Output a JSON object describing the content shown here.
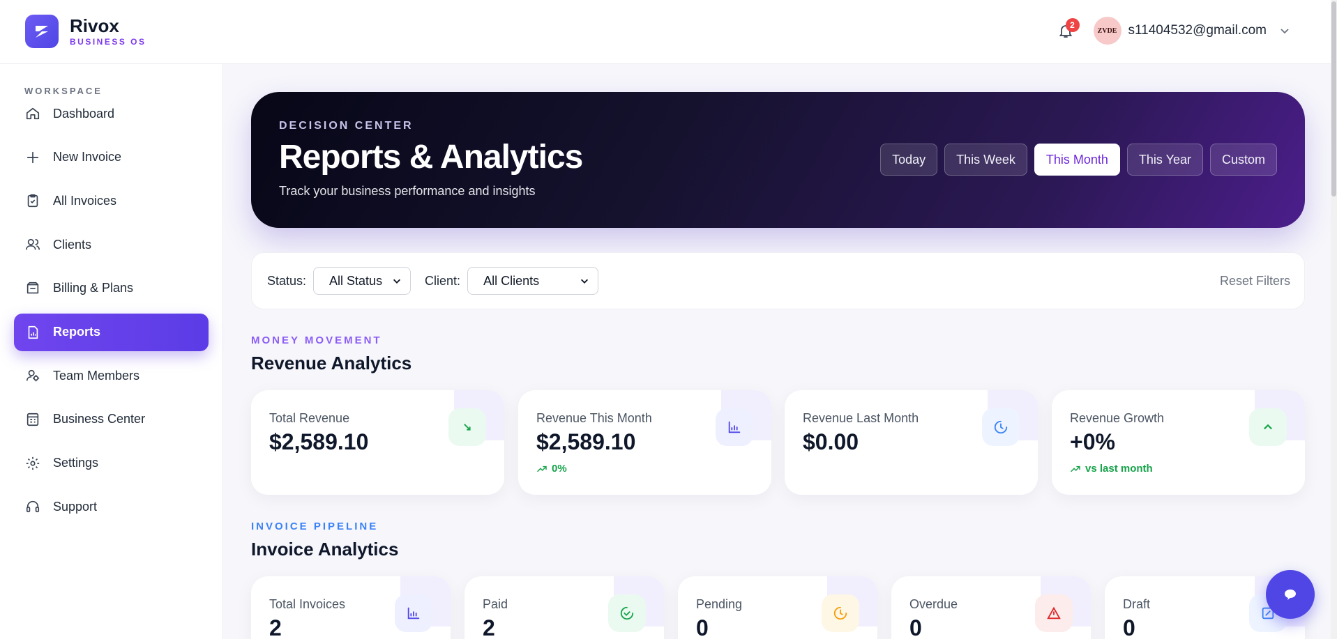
{
  "brand": {
    "name": "Rivox",
    "sub": "BUSINESS OS"
  },
  "header": {
    "notifications_count": "2",
    "avatar_text": "ZVDE",
    "user_email": "s11404532@gmail.com"
  },
  "sidebar": {
    "section_label": "WORKSPACE",
    "items": [
      {
        "label": "Dashboard",
        "icon": "home-icon"
      },
      {
        "label": "New Invoice",
        "icon": "plus-icon"
      },
      {
        "label": "All Invoices",
        "icon": "clipboard-check-icon"
      },
      {
        "label": "Clients",
        "icon": "users-icon"
      },
      {
        "label": "Billing & Plans",
        "icon": "wallet-icon"
      },
      {
        "label": "Reports",
        "icon": "report-icon",
        "active": true
      },
      {
        "label": "Team Members",
        "icon": "team-icon"
      },
      {
        "label": "Business Center",
        "icon": "building-icon"
      },
      {
        "label": "Settings",
        "icon": "gear-icon"
      },
      {
        "label": "Support",
        "icon": "headset-icon"
      }
    ]
  },
  "hero": {
    "kicker": "DECISION CENTER",
    "title": "Reports & Analytics",
    "subtitle": "Track your business performance and insights",
    "periods": [
      "Today",
      "This Week",
      "This Month",
      "This Year",
      "Custom"
    ],
    "active_period": "This Month"
  },
  "filters": {
    "status_label": "Status:",
    "status_value": "All Status",
    "client_label": "Client:",
    "client_value": "All Clients",
    "reset_label": "Reset Filters"
  },
  "revenue": {
    "kicker": "MONEY MOVEMENT",
    "title": "Revenue Analytics",
    "cards": [
      {
        "label": "Total Revenue",
        "value": "$2,589.10",
        "trend": "",
        "icon": "money-icon"
      },
      {
        "label": "Revenue This Month",
        "value": "$2,589.10",
        "trend": "0%",
        "icon": "chart-icon"
      },
      {
        "label": "Revenue Last Month",
        "value": "$0.00",
        "trend": "",
        "icon": "clock-icon"
      },
      {
        "label": "Revenue Growth",
        "value": "+0%",
        "trend": "vs last month",
        "icon": "chevron-up-icon"
      }
    ]
  },
  "invoices": {
    "kicker": "INVOICE PIPELINE",
    "title": "Invoice Analytics",
    "cards": [
      {
        "label": "Total Invoices",
        "value": "2",
        "icon": "chart-icon"
      },
      {
        "label": "Paid",
        "value": "2",
        "icon": "check-circle-icon"
      },
      {
        "label": "Pending",
        "value": "0",
        "icon": "clock-icon"
      },
      {
        "label": "Overdue",
        "value": "0",
        "icon": "alert-icon"
      },
      {
        "label": "Draft",
        "value": "0",
        "icon": "edit-icon"
      }
    ]
  },
  "colors": {
    "accent": "#6d28d9",
    "active_nav": "#6341ea",
    "success": "#16a34a"
  }
}
